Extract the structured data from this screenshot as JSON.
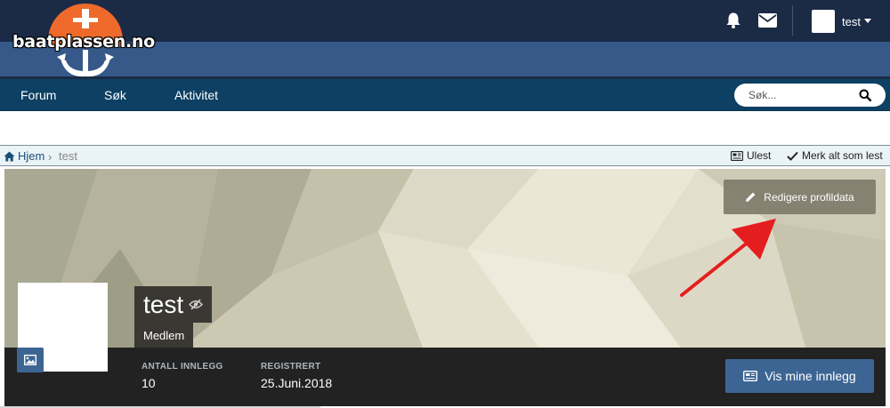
{
  "header": {
    "logo_text": "baatplassen.no",
    "user": {
      "name": "test"
    },
    "icons": {
      "notifications": "bell-icon",
      "messages": "envelope-icon"
    }
  },
  "nav": {
    "items": [
      {
        "label": "Forum"
      },
      {
        "label": "Søk"
      },
      {
        "label": "Aktivitet"
      }
    ],
    "search": {
      "placeholder": "Søk..."
    }
  },
  "breadcrumb": {
    "home": "Hjem",
    "current": "test",
    "actions": {
      "unread": "Ulest",
      "mark_read": "Merk alt som lest"
    }
  },
  "profile": {
    "edit_label": "Redigere profildata",
    "name": "test",
    "role": "Medlem",
    "stats": [
      {
        "label": "ANTALL INNLEGG",
        "value": "10"
      },
      {
        "label": "REGISTRERT",
        "value": "25.Juni.2018"
      }
    ],
    "view_posts_label": "Vis mine innlegg"
  },
  "colors": {
    "header_dark": "#1b2b46",
    "header_band": "#36598a",
    "nav": "#0d4063",
    "logo_orange": "#ee6a2a",
    "accent_button": "#3d6594",
    "annotation_arrow": "#e41e1e"
  }
}
